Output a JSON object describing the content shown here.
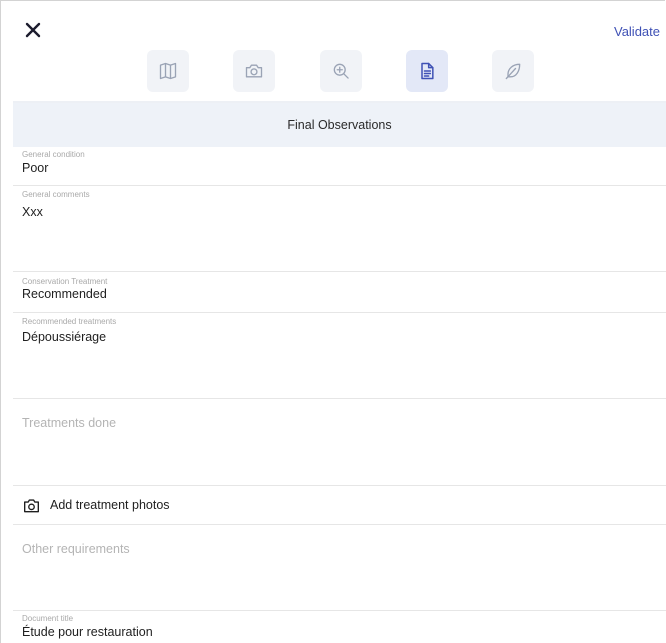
{
  "header": {
    "validate_label": "Validate"
  },
  "tabs": [
    {
      "name": "book-icon",
      "active": false
    },
    {
      "name": "camera-icon",
      "active": false
    },
    {
      "name": "zoom-in-icon",
      "active": false
    },
    {
      "name": "document-icon",
      "active": true
    },
    {
      "name": "feather-icon",
      "active": false
    }
  ],
  "section": {
    "title": "Final Observations"
  },
  "fields": {
    "general_condition": {
      "label": "General condition",
      "value": "Poor"
    },
    "general_comments": {
      "label": "General comments",
      "value": "Xxx"
    },
    "conservation_treatment": {
      "label": "Conservation Treatment",
      "value": "Recommended"
    },
    "recommended_treatments": {
      "label": "Recommended treatments",
      "value": "Dépoussiérage"
    },
    "treatments_done": {
      "placeholder": "Treatments done"
    },
    "add_photos": {
      "label": "Add treatment photos"
    },
    "other_requirements": {
      "placeholder": "Other requirements"
    },
    "document_title": {
      "label": "Document title",
      "value": "Étude pour restauration"
    }
  },
  "colors": {
    "accent": "#3f51b5",
    "tab_bg": "#f1f3f7",
    "tab_active_bg": "#e3e8f7",
    "band_bg": "#eef2f8"
  }
}
